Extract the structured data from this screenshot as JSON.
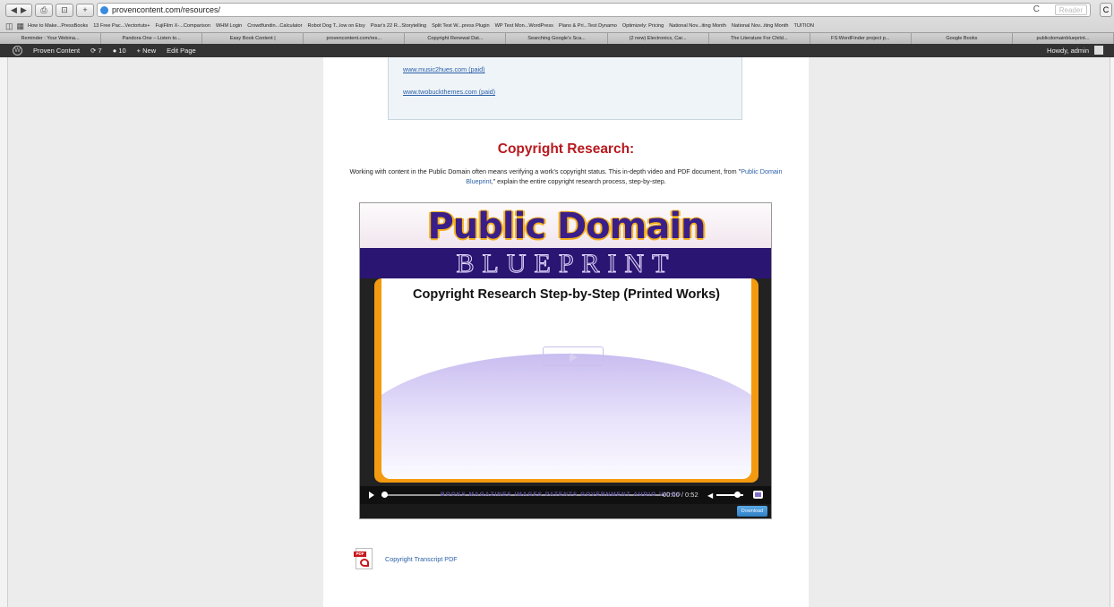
{
  "browser": {
    "url": "provencontent.com/resources/",
    "reader_label": "Reader",
    "bookmarks": [
      "How to Make...PressBooks",
      "13 Free Pac...Vectortuts+",
      "FujiFilm X-...Comparison",
      "WHM Login",
      "Crowdfundin...Calculator",
      "Robot Dog T...low on Etsy",
      "Pixar's 22 R...Storytelling",
      "Split Test W...press Plugin",
      "WP Test Mon...WordPress",
      "Plans & Pri...Test Dynamo",
      "Optimizely: Pricing",
      "National Nov...iting Month",
      "National Nov...iting Month",
      "TUITION"
    ],
    "tabs": [
      "Reminder : Your Webina...",
      "Pandora One – Listen to...",
      "Easy Book Content |",
      "provencontent.com/res...",
      "Copyright Renewal Dat...",
      "Searching Google's Sca...",
      "(2 new) Electronics, Car...",
      "The Literature For Child...",
      "FS:WordFinder project p...",
      "Google Books",
      "publicdomainblueprint..."
    ]
  },
  "adminbar": {
    "site": "Proven Content",
    "updates": "7",
    "comments": "10",
    "new_label": "New",
    "edit_label": "Edit Page",
    "howdy": "Howdy, admin"
  },
  "links": [
    "www.music2hues.com (paid)",
    "www.twobuckthemes.com (paid)"
  ],
  "section": {
    "heading": "Copyright Research:",
    "desc_before": "Working with content in the Public Domain often means verifying a work's copyright status. This in-depth video and PDF document, from \"",
    "desc_link": "Public Domain Blueprint",
    "desc_after": ",\" explain the entire copyright research process, step-by-step."
  },
  "video": {
    "brand_title": "Public Domain",
    "brand_subtitle": "BLUEPRINT",
    "slide_title": "Copyright Research Step-by-Step (Printed Works)",
    "nav_strip": "BOOKS   MAGAZINES   IMAGES   PATENTS   GOVERNMENT   AUDIO   VIDEO",
    "time": "00:00 / 0:52",
    "download_label": "Download"
  },
  "pdf": {
    "label": "Copyright Transcript PDF",
    "icon_tag": "PDF"
  }
}
